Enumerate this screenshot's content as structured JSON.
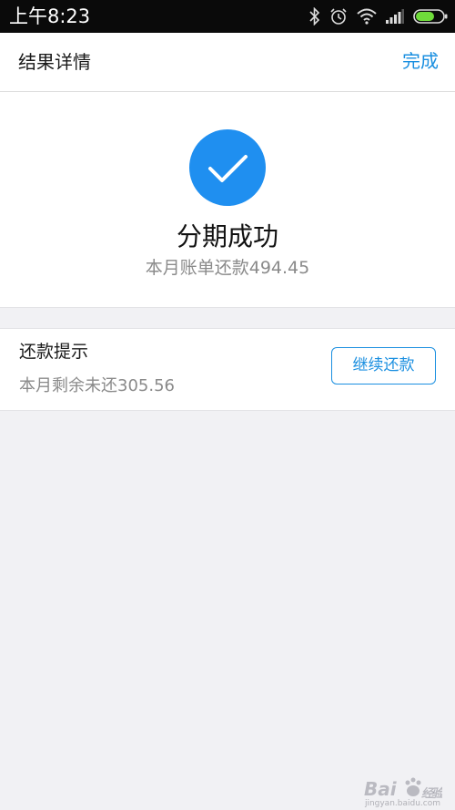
{
  "status_bar": {
    "time": "上午8:23",
    "icons": [
      "bluetooth-icon",
      "alarm-icon",
      "wifi-icon",
      "signal-icon",
      "battery-icon"
    ]
  },
  "nav": {
    "title": "结果详情",
    "done_label": "完成"
  },
  "result": {
    "icon": "checkmark-icon",
    "title": "分期成功",
    "subtitle": "本月账单还款494.45"
  },
  "repay_tip": {
    "title": "还款提示",
    "remaining": "本月剩余未还305.56",
    "button_label": "继续还款"
  },
  "watermark": {
    "logo_text": "Bai经验",
    "domain": "jingyan.baidu.com"
  },
  "colors": {
    "accent": "#1a8fe0",
    "check_circle": "#1f8ff0",
    "page_background": "#f1f1f4",
    "status_bar": "#0a0a0a"
  }
}
